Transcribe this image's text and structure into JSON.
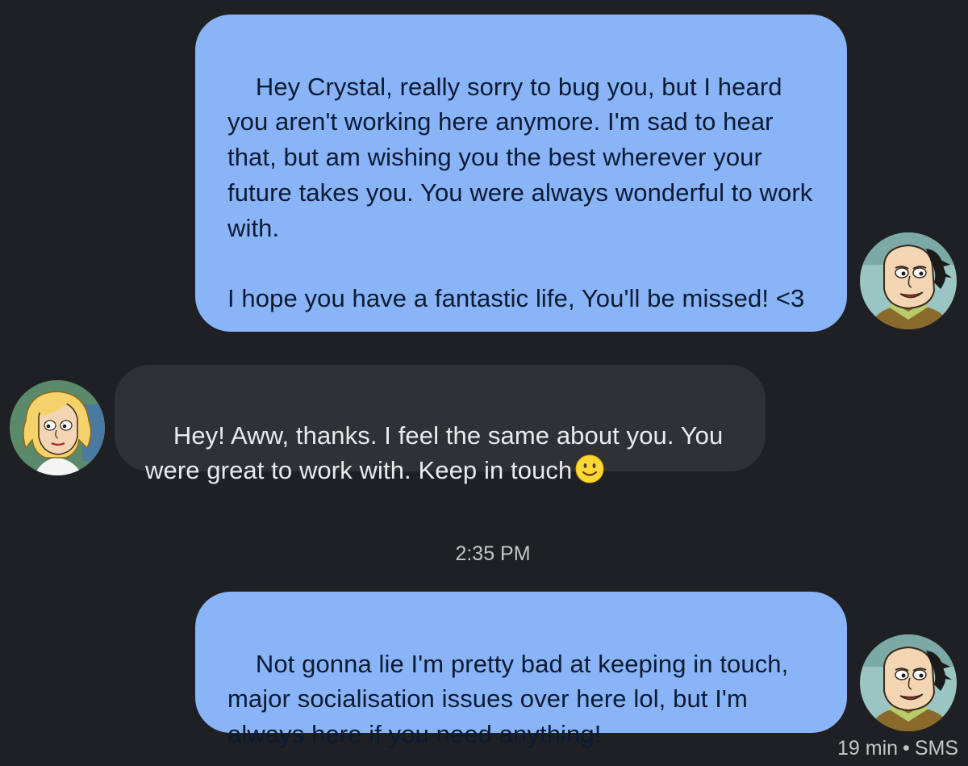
{
  "conversation": {
    "messages": [
      {
        "direction": "outgoing",
        "text": "Hey Crystal, really sorry to bug you, but I heard you aren't working here anymore. I'm sad to hear that, but am wishing you the best wherever your future takes you. You were always wonderful to work with.\n\nI hope you have a fantastic life, You'll be missed! <3"
      },
      {
        "direction": "incoming",
        "text": "Hey! Aww, thanks. I feel the same about you. You were great to work with. Keep in touch",
        "emoji": "slightly-smiling-face-icon"
      },
      {
        "direction": "outgoing",
        "text": "Not gonna lie I'm pretty bad at keeping in touch, major socialisation issues over here lol, but I'm always here if you need anything!"
      }
    ],
    "timestamp": "2:35 PM",
    "status": {
      "time": "19 min",
      "separator": "•",
      "type": "SMS"
    }
  },
  "colors": {
    "background": "#1f2024",
    "outgoing_bubble": "#8ab4f8",
    "incoming_bubble": "#303134",
    "meta_text": "#c4c7c5"
  },
  "icons": {
    "sender_avatar": "cartoon-man-avatar",
    "contact_avatar": "cartoon-woman-avatar"
  }
}
